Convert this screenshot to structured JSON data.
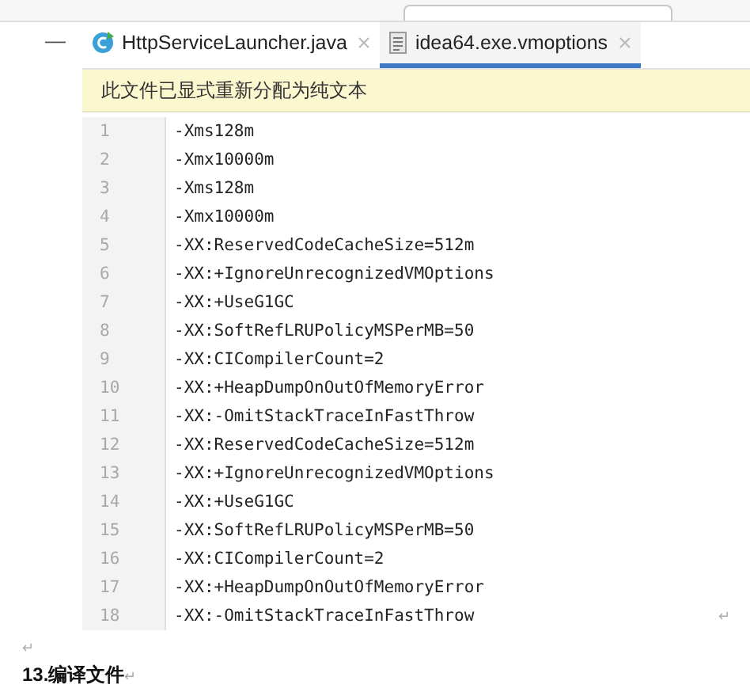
{
  "tabs": [
    {
      "label": "HttpServiceLauncher.java",
      "kind": "java",
      "selected": false
    },
    {
      "label": "idea64.exe.vmoptions",
      "kind": "text",
      "selected": true
    }
  ],
  "collapse_symbol": "—",
  "banner": "此文件已显式重新分配为纯文本",
  "lines": [
    {
      "number": "1",
      "code": "-Xms128m"
    },
    {
      "number": "2",
      "code": "-Xmx10000m"
    },
    {
      "number": "3",
      "code": "-Xms128m"
    },
    {
      "number": "4",
      "code": "-Xmx10000m"
    },
    {
      "number": "5",
      "code": "-XX:ReservedCodeCacheSize=512m"
    },
    {
      "number": "6",
      "code": "-XX:+IgnoreUnrecognizedVMOptions"
    },
    {
      "number": "7",
      "code": "-XX:+UseG1GC"
    },
    {
      "number": "8",
      "code": "-XX:SoftRefLRUPolicyMSPerMB=50"
    },
    {
      "number": "9",
      "code": "-XX:CICompilerCount=2"
    },
    {
      "number": "10",
      "code": "-XX:+HeapDumpOnOutOfMemoryError"
    },
    {
      "number": "11",
      "code": "-XX:-OmitStackTraceInFastThrow"
    },
    {
      "number": "12",
      "code": "-XX:ReservedCodeCacheSize=512m"
    },
    {
      "number": "13",
      "code": "-XX:+IgnoreUnrecognizedVMOptions"
    },
    {
      "number": "14",
      "code": "-XX:+UseG1GC"
    },
    {
      "number": "15",
      "code": "-XX:SoftRefLRUPolicyMSPerMB=50"
    },
    {
      "number": "16",
      "code": "-XX:CICompilerCount=2"
    },
    {
      "number": "17",
      "code": "-XX:+HeapDumpOnOutOfMemoryError"
    },
    {
      "number": "18",
      "code": "-XX:-OmitStackTraceInFastThrow"
    }
  ],
  "paragraph_marks": [
    "↵",
    "↵"
  ],
  "heading": {
    "text": "13.编译文件",
    "mark": "↵"
  }
}
